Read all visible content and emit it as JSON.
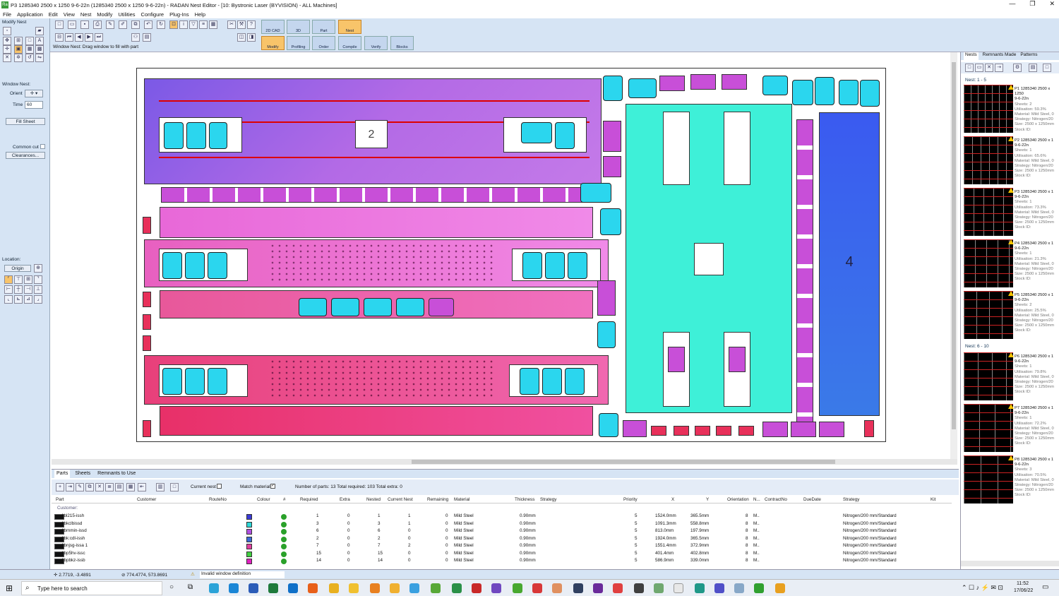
{
  "window": {
    "title": "P3 1285340 2500 x 1250 9-6-22n (1285340 2500 x 1250 9-6-22n) - RADAN Nest Editor - [10: Bystronic Laser (BYVISION) - ALL Machines]",
    "controls": [
      "—",
      "❐",
      "✕"
    ]
  },
  "menu": [
    "File",
    "Application",
    "Edit",
    "View",
    "Nest",
    "Modify",
    "Utilities",
    "Configure",
    "Plug-Ins",
    "Help"
  ],
  "toolbar": {
    "top_buttons": [
      "2D CAD",
      "3D",
      "Part",
      "Nest"
    ],
    "bottom_buttons": [
      "Modify",
      "Profiling",
      "Order",
      "Compile",
      "Verify",
      "Blocks"
    ],
    "prompt": "Window Nest: Drag window to fill with part"
  },
  "left_panel": {
    "modify_nest": "Modify Nest",
    "window_nest": "Window Nest:",
    "orient_label": "Orient",
    "time_label": "Time",
    "time_value": "60",
    "fill_sheet": "Fill Sheet",
    "common_cut": "Common cut",
    "clearances": "Clearances...",
    "location": "Location:",
    "origin": "Origin"
  },
  "canvas": {
    "labels": [
      "2",
      "4"
    ]
  },
  "bottom": {
    "tabs": [
      "Parts",
      "Sheets",
      "Remnants to Use"
    ],
    "current_nest": "Current nest",
    "match_material": "Match material",
    "summary": "Number of parts: 13   Total required: 103   Total extra: 0",
    "headers": [
      "Part",
      "Customer",
      "RouteNo",
      "Colour",
      "#",
      "Required",
      "Extra",
      "Nested",
      "Current Nest",
      "Remaining",
      "Material",
      "Thickness",
      "Strategy",
      "Priority",
      "X",
      "Y",
      "Orientation",
      "N...",
      "ContractNo",
      "DueDate",
      "Strategy",
      "Kit"
    ],
    "group": "Customer:",
    "rows": [
      {
        "part": "1bl215-issh",
        "color": "#3b3bd6",
        "required": "1",
        "extra": "0",
        "nested": "1",
        "current": "1",
        "remaining": "0",
        "material": "Mild Steel",
        "thickness": "0.90mm",
        "priority": "5",
        "x": "1524.0mm",
        "y": "365.5mm",
        "orient": "8",
        "n": "M..",
        "strategy": "Nitrogen/200 mm/Standard"
      },
      {
        "part": "1bkclbissd",
        "color": "#2bd6d6",
        "required": "3",
        "extra": "0",
        "nested": "3",
        "current": "1",
        "remaining": "0",
        "material": "Mild Steel",
        "thickness": "0.90mm",
        "priority": "5",
        "x": "1091.3mm",
        "y": "558.8mm",
        "orient": "8",
        "n": "M..",
        "strategy": "Nitrogen/200 mm/Standard"
      },
      {
        "part": "1bmmin-issd",
        "color": "#b050e0",
        "required": "6",
        "extra": "0",
        "nested": "6",
        "current": "0",
        "remaining": "0",
        "material": "Mild Steel",
        "thickness": "0.90mm",
        "priority": "5",
        "x": "813.0mm",
        "y": "197.9mm",
        "orient": "8",
        "n": "M..",
        "strategy": "Nitrogen/200 mm/Standard"
      },
      {
        "part": "1bk:cdl-issh",
        "color": "#3b6ad6",
        "required": "2",
        "extra": "0",
        "nested": "2",
        "current": "0",
        "remaining": "0",
        "material": "Mild Steel",
        "thickness": "0.90mm",
        "priority": "5",
        "x": "1924.0mm",
        "y": "365.5mm",
        "orient": "8",
        "n": "M..",
        "strategy": "Nitrogen/200 mm/Standard"
      },
      {
        "part": "1bnjsg-issa 1",
        "color": "#e040a0",
        "required": "7",
        "extra": "0",
        "nested": "7",
        "current": "2",
        "remaining": "0",
        "material": "Mild Steel",
        "thickness": "0.90mm",
        "priority": "5",
        "x": "1551.4mm",
        "y": "372.9mm",
        "orient": "8",
        "n": "M..",
        "strategy": "Nitrogen/200 mm/Standard"
      },
      {
        "part": "1bp5hv-issc",
        "color": "#40d040",
        "required": "15",
        "extra": "0",
        "nested": "15",
        "current": "0",
        "remaining": "0",
        "material": "Mild Steel",
        "thickness": "0.90mm",
        "priority": "5",
        "x": "401.4mm",
        "y": "402.8mm",
        "orient": "8",
        "n": "M..",
        "strategy": "Nitrogen/200 mm/Standard"
      },
      {
        "part": "1bpbkz-issb",
        "color": "#e020c0",
        "required": "14",
        "extra": "0",
        "nested": "14",
        "current": "0",
        "remaining": "0",
        "material": "Mild Steel",
        "thickness": "0.90mm",
        "priority": "5",
        "x": "586.9mm",
        "y": "339.0mm",
        "orient": "8",
        "n": "M..",
        "strategy": "Nitrogen/200 mm/Standard"
      }
    ]
  },
  "right_panel": {
    "tabs": [
      "Nests",
      "Remnants Made",
      "Patterns"
    ],
    "group1": "Nest: 1 - 5",
    "group2": "Nest: 6 - 10",
    "nests": [
      {
        "title": "P1 1285340 2500 x 1250",
        "sub": "9-6-22n",
        "sheets": "Sheets: 2",
        "util": "Utilisation: 59.3%",
        "material": "Material: Mild Steel, 0",
        "strategy": "Strategy: Nitrogen/20",
        "size": "Size: 2500 x 1250mm",
        "stock": "Stock ID:"
      },
      {
        "title": "P2 1285340 2500 x 1",
        "sub": "9-6-22n",
        "sheets": "Sheets: 1",
        "util": "Utilisation: 65.6%",
        "material": "Material: Mild Steel, 0",
        "strategy": "Strategy: Nitrogen/20",
        "size": "Size: 2500 x 1250mm",
        "stock": "Stock ID:"
      },
      {
        "title": "P3 1285340 2500 x 1",
        "sub": "9-6-22n",
        "sheets": "Sheets: 1",
        "util": "Utilisation: 73.3%",
        "material": "Material: Mild Steel, 0",
        "strategy": "Strategy: Nitrogen/20",
        "size": "Size: 2500 x 1250mm",
        "stock": "Stock ID:"
      },
      {
        "title": "P4 1285340 2500 x 1",
        "sub": "9-6-22n",
        "sheets": "Sheets: 1",
        "util": "Utilisation: 21.3%",
        "material": "Material: Mild Steel, 0",
        "strategy": "Strategy: Nitrogen/20",
        "size": "Size: 2500 x 1250mm",
        "stock": "Stock ID:"
      },
      {
        "title": "P5 1285340 2500 x 1",
        "sub": "9-6-22n",
        "sheets": "Sheets: 2",
        "util": "Utilisation: 25.5%",
        "material": "Material: Mild Steel, 0",
        "strategy": "Strategy: Nitrogen/20",
        "size": "Size: 2500 x 1250mm",
        "stock": "Stock ID:"
      },
      {
        "title": "P6 1285340 2500 x 1",
        "sub": "9-6-22n",
        "sheets": "Sheets: 1",
        "util": "Utilisation: 79.8%",
        "material": "Material: Mild Steel, 0",
        "strategy": "Strategy: Nitrogen/20",
        "size": "Size: 2500 x 1250mm",
        "stock": "Stock ID:"
      },
      {
        "title": "P7 1285340 2500 x 1",
        "sub": "9-6-22n",
        "sheets": "Sheets: 1",
        "util": "Utilisation: 72.2%",
        "material": "Material: Mild Steel, 0",
        "strategy": "Strategy: Nitrogen/20",
        "size": "Size: 2500 x 1250mm",
        "stock": "Stock ID:"
      },
      {
        "title": "P8 1285340 2500 x 1",
        "sub": "9-6-22n",
        "sheets": "Sheets: 3",
        "util": "Utilisation: 70.5%",
        "material": "Material: Mild Steel, 0",
        "strategy": "Strategy: Nitrogen/20",
        "size": "Size: 2500 x 1250mm",
        "stock": "Stock ID:"
      }
    ]
  },
  "status": {
    "coord1": "2.7719, -3.4891",
    "coord2": "774.4774, 573.8691",
    "message": "Invalid window definition"
  },
  "taskbar": {
    "search": "Type here to search",
    "time": "11:52",
    "date": "17/06/22"
  }
}
